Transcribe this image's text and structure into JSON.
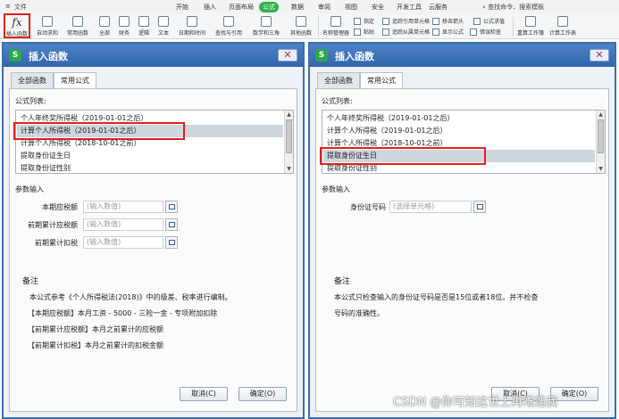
{
  "ribbon": {
    "menu": [
      "文件",
      "开始",
      "插入",
      "页面布局",
      "公式",
      "数据",
      "审阅",
      "视图",
      "安全",
      "开发工具",
      "云服务"
    ],
    "active_tab": "公式",
    "search": "查找命令、搜索模板",
    "fx_label": "插入函数",
    "fx_glyph": "fx",
    "tools": [
      "自动求和",
      "常用函数",
      "全部",
      "财务",
      "逻辑",
      "文本",
      "日期和时间",
      "查找与引用",
      "数学和三角",
      "其他函数",
      "名称管理器",
      "计算工作表",
      "重算工作簿"
    ],
    "small_tools": [
      "指定",
      "粘贴",
      "追踪引用单元格",
      "追踪从属单元格",
      "移去箭头",
      "显示公式",
      "错误检查",
      "公式求值"
    ]
  },
  "left_dialog": {
    "title": "插入函数",
    "close": "✕",
    "tabs": [
      "全部函数",
      "常用公式"
    ],
    "list_label": "公式列表:",
    "items": [
      "个人年终奖所得税（2019-01-01之后）",
      "计算个人所得税（2019-01-01之后）",
      "计算个人所得税（2018-10-01之前）",
      "提取身份证生日",
      "提取身份证性别"
    ],
    "selected_index": 1,
    "params_label": "参数输入",
    "fields": [
      {
        "label": "本期应税额",
        "placeholder": "(输入数值)"
      },
      {
        "label": "前期累计应税额",
        "placeholder": "(输入数值)"
      },
      {
        "label": "前期累计扣税",
        "placeholder": "(输入数值)"
      }
    ],
    "note_title": "备注",
    "note_lines": [
      "本公式参考《个人所得税法(2018)》中的级差、税率进行编制。",
      "【本期应税额】本月工资 - 5000 - 三险一金 - 专项附加扣除",
      "【前期累计应税额】本月之前累计的应税额",
      "【前期累计扣税】本月之前累计的扣税金额"
    ],
    "cancel": "取消(C)",
    "ok": "确定(O)"
  },
  "right_dialog": {
    "title": "插入函数",
    "close": "✕",
    "tabs": [
      "全部函数",
      "常用公式"
    ],
    "list_label": "公式列表:",
    "items": [
      "个人年终奖所得税（2019-01-01之后）",
      "计算个人所得税（2019-01-01之后）",
      "计算个人所得税（2018-10-01之前）",
      "提取身份证生日",
      "提取身份证性别"
    ],
    "selected_index": 3,
    "params_label": "参数输入",
    "fields": [
      {
        "label": "身份证号码",
        "placeholder": "(选择单元格)"
      }
    ],
    "note_title": "备注",
    "note_lines": [
      "本公式只检查输入的身份证号码是否是15位或者18位。并不检查",
      "号码的准确性。"
    ],
    "cancel": "取消(C)",
    "ok": "确定(O)"
  },
  "watermark": "CSDN @你可知这世上再难遇我"
}
